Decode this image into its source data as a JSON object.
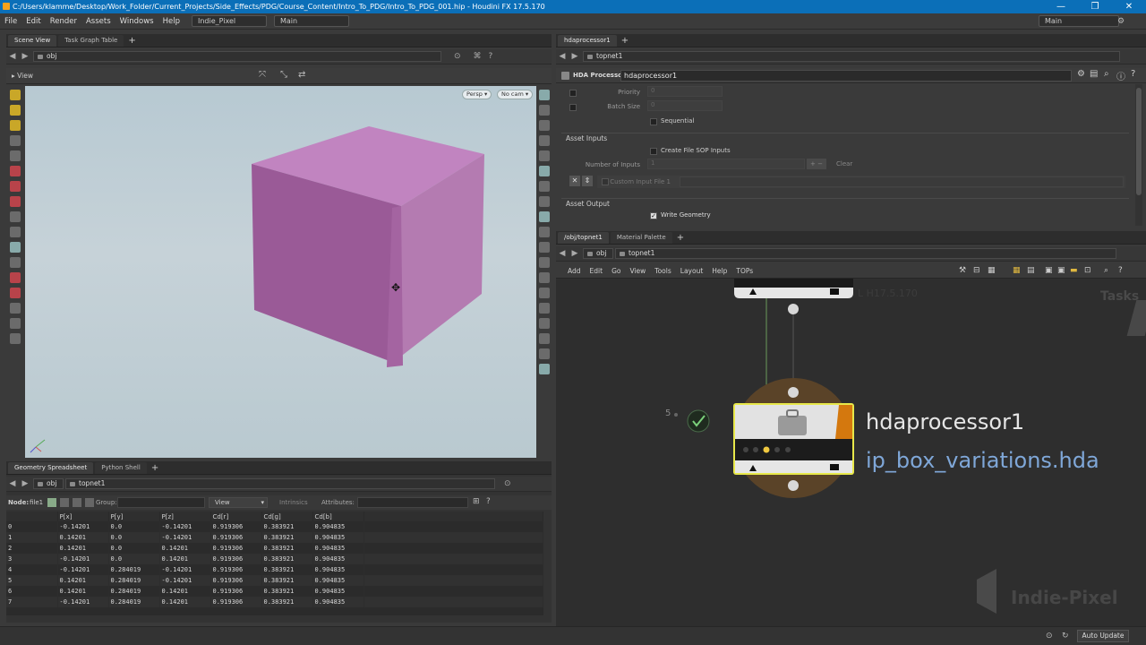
{
  "window": {
    "title": "C:/Users/klamme/Desktop/Work_Folder/Current_Projects/Side_Effects/PDG/Course_Content/Intro_To_PDG/Intro_To_PDG_001.hip - Houdini FX 17.5.170",
    "controls": [
      "—",
      "❐",
      "✕"
    ]
  },
  "menubar": {
    "items": [
      "File",
      "Edit",
      "Render",
      "Assets",
      "Windows",
      "Help"
    ],
    "desktop": "Indie_Pixel",
    "context": "Main",
    "right_desktop": "Main"
  },
  "scene_panel": {
    "tabs": [
      "Scene View",
      "Task Graph Table"
    ],
    "path": "obj",
    "view_label": "View",
    "persp": "Persp",
    "cam": "No cam"
  },
  "spreadsheet_panel": {
    "tabs": [
      "Geometry Spreadsheet",
      "Python Shell"
    ],
    "path_obj": "obj",
    "path_node": "topnet1",
    "node_label": "Node:",
    "node_value": "file1",
    "group_label": "Group:",
    "view_label": "View",
    "intrinsics_label": "Intrinsics",
    "attributes_label": "Attributes:",
    "columns": [
      "",
      "P[x]",
      "P[y]",
      "P[z]",
      "Cd[r]",
      "Cd[g]",
      "Cd[b]"
    ],
    "rows": [
      [
        "0",
        "-0.14201",
        "0.0",
        "-0.14201",
        "0.919306",
        "0.383921",
        "0.904835"
      ],
      [
        "1",
        "0.14201",
        "0.0",
        "-0.14201",
        "0.919306",
        "0.383921",
        "0.904835"
      ],
      [
        "2",
        "0.14201",
        "0.0",
        "0.14201",
        "0.919306",
        "0.383921",
        "0.904835"
      ],
      [
        "3",
        "-0.14201",
        "0.0",
        "0.14201",
        "0.919306",
        "0.383921",
        "0.904835"
      ],
      [
        "4",
        "-0.14201",
        "0.284019",
        "-0.14201",
        "0.919306",
        "0.383921",
        "0.904835"
      ],
      [
        "5",
        "0.14201",
        "0.284019",
        "-0.14201",
        "0.919306",
        "0.383921",
        "0.904835"
      ],
      [
        "6",
        "0.14201",
        "0.284019",
        "0.14201",
        "0.919306",
        "0.383921",
        "0.904835"
      ],
      [
        "7",
        "-0.14201",
        "0.284019",
        "0.14201",
        "0.919306",
        "0.383921",
        "0.904835"
      ]
    ]
  },
  "param_panel": {
    "tab": "hdaprocessor1",
    "path": "topnet1",
    "node_type": "HDA Processor",
    "node_name": "hdaprocessor1",
    "priority_label": "Priority",
    "priority_value": "0",
    "batch_label": "Batch Size",
    "batch_value": "0",
    "sequential_label": "Sequential",
    "asset_inputs_label": "Asset Inputs",
    "create_file_sop_label": "Create File SOP Inputs",
    "num_inputs_label": "Number of Inputs",
    "num_inputs_value": "1",
    "clear_label": "Clear",
    "custom_input_label": "Custom Input File 1",
    "asset_output_label": "Asset Output",
    "write_geo_label": "Write Geometry"
  },
  "network_panel": {
    "tabs": [
      "/obj/topnet1",
      "Material Palette"
    ],
    "path_obj": "obj",
    "path_node": "topnet1",
    "menu": [
      "Add",
      "Edit",
      "Go",
      "View",
      "Tools",
      "Layout",
      "Help",
      "TOPs"
    ],
    "watermark_version": "L H17.5.170",
    "tasks_label": "Tasks",
    "node_name": "hdaprocessor1",
    "node_hda": "ip_box_variations.hda",
    "work_count": "5",
    "brand_watermark": "Indie-Pixel",
    "colors": {
      "node_name": "#e6e6e6",
      "hda_link": "#7fa7d8",
      "halo": "#5a4328",
      "cube": "#b36eb0"
    }
  },
  "statusbar": {
    "update_mode": "Auto Update"
  }
}
